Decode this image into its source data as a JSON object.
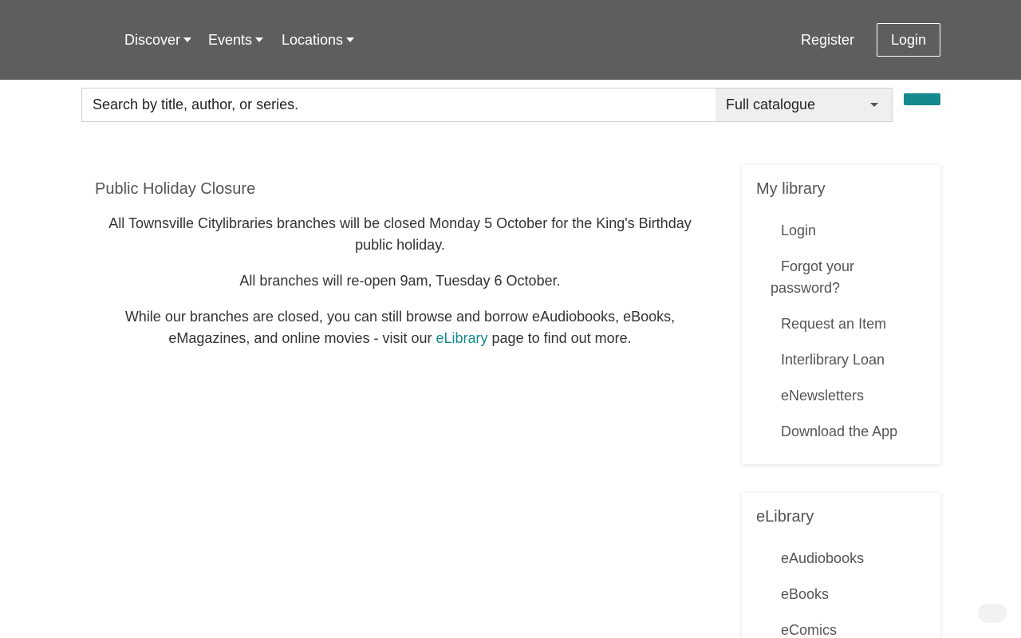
{
  "nav": {
    "discover": "Discover",
    "events": "Events",
    "locations": "Locations",
    "register": "Register",
    "login": "Login"
  },
  "search": {
    "placeholder": "Search by title, author, or series.",
    "scope": "Full catalogue"
  },
  "notice": {
    "title": "Public Holiday Closure",
    "para1": "All Townsville Citylibraries branches will be closed Monday 5 October for the King's Birthday public holiday.",
    "para2": "All branches will re-open 9am, Tuesday 6 October.",
    "para3_pre": "While our branches are closed, you can still browse and borrow eAudiobooks, eBooks, eMagazines, and online movies - visit our ",
    "para3_link": "eLibrary",
    "para3_post": " page to find out more."
  },
  "my_library": {
    "title": "My library",
    "items": [
      "Login",
      "Forgot your password?",
      "Request an Item",
      "Interlibrary Loan",
      "eNewsletters",
      "Download the App"
    ]
  },
  "elibrary": {
    "title": "eLibrary",
    "items": [
      "eAudiobooks",
      "eBooks",
      "eComics"
    ]
  },
  "colors": {
    "header_bg": "#5e5e5e",
    "accent": "#148a8e",
    "select_bg": "#efefef"
  }
}
